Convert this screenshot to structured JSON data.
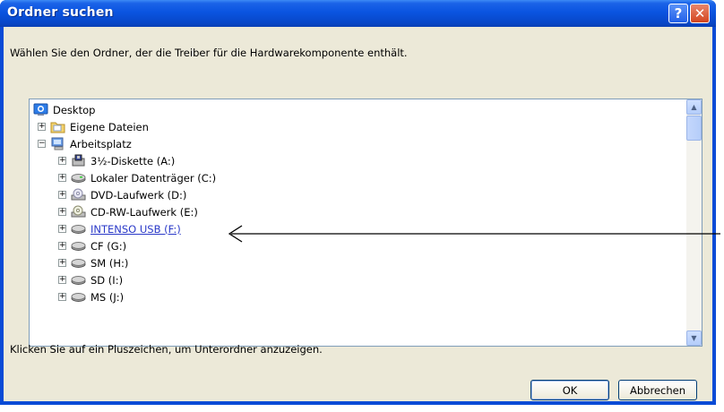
{
  "window": {
    "title": "Ordner suchen",
    "help_label": "?",
    "close_label": "✕"
  },
  "instruction": "Wählen Sie den Ordner, der die Treiber für die Hardwarekomponente enthält.",
  "tree": {
    "items": [
      {
        "label": "Desktop",
        "icon": "desktop-icon",
        "expander": ""
      },
      {
        "label": "Eigene Dateien",
        "icon": "folder-icon",
        "expander": "+"
      },
      {
        "label": "Arbeitsplatz",
        "icon": "computer-icon",
        "expander": "−"
      },
      {
        "label": "3½-Diskette (A:)",
        "icon": "floppy-drive-icon",
        "expander": "+"
      },
      {
        "label": "Lokaler Datenträger (C:)",
        "icon": "hard-drive-icon",
        "expander": "+"
      },
      {
        "label": "DVD-Laufwerk (D:)",
        "icon": "dvd-drive-icon",
        "expander": "+"
      },
      {
        "label": "CD-RW-Laufwerk (E:)",
        "icon": "cd-drive-icon",
        "expander": "+"
      },
      {
        "label": "INTENSO USB (F:)",
        "icon": "usb-drive-icon",
        "expander": "+",
        "selected": true
      },
      {
        "label": "CF (G:)",
        "icon": "removable-drive-icon",
        "expander": "+"
      },
      {
        "label": "SM (H:)",
        "icon": "removable-drive-icon",
        "expander": "+"
      },
      {
        "label": "SD (I:)",
        "icon": "removable-drive-icon",
        "expander": "+"
      },
      {
        "label": "MS (J:)",
        "icon": "removable-drive-icon",
        "expander": "+"
      }
    ]
  },
  "hint": "Klicken Sie auf ein Pluszeichen, um Unterordner anzuzeigen.",
  "buttons": {
    "ok": "OK",
    "cancel": "Abbrechen"
  },
  "colors": {
    "titlebar": "#0a54e0",
    "dialog_bg": "#ece9d8",
    "selection_text": "#2a39c8",
    "annotation_arrow": "#000000"
  }
}
